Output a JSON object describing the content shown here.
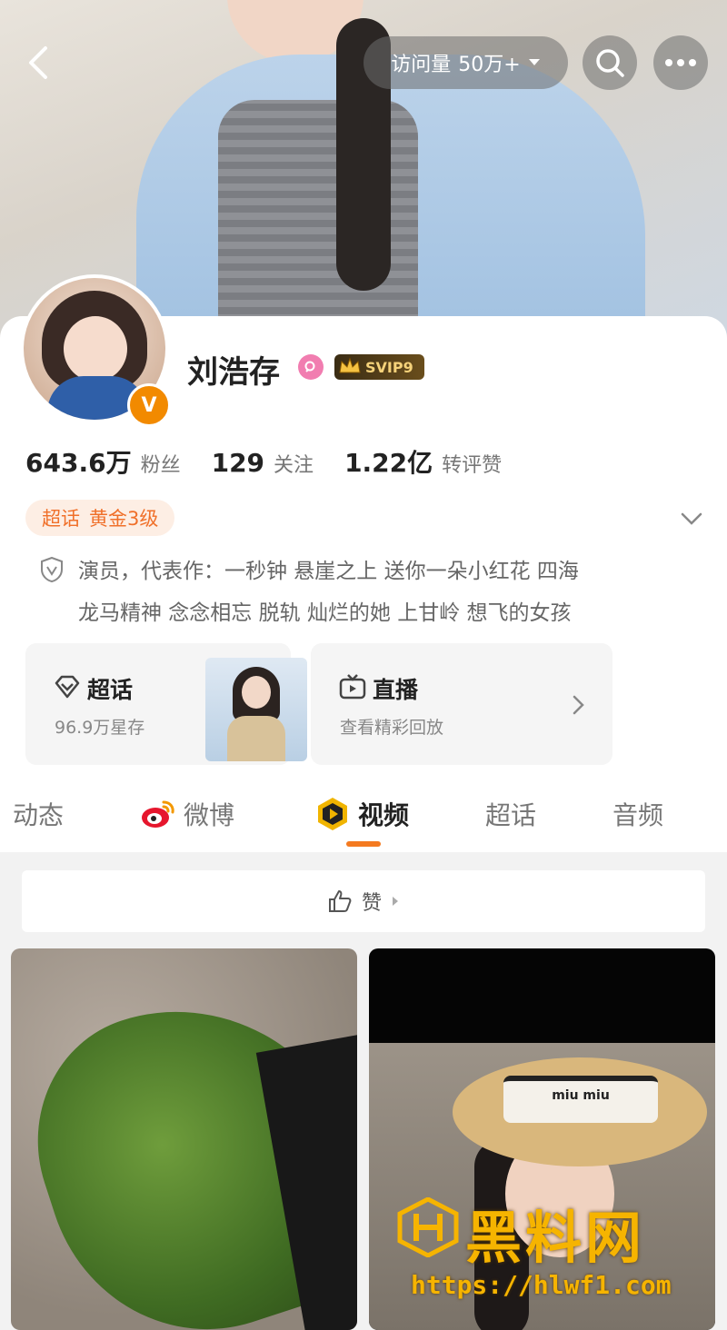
{
  "header": {
    "visit_label": "访问量",
    "visit_count": "50万+"
  },
  "profile": {
    "name": "刘浩存",
    "svip_label": "SVIP9",
    "verified_mark": "V",
    "stats": [
      {
        "value": "643.6万",
        "label": "粉丝"
      },
      {
        "value": "129",
        "label": "关注"
      },
      {
        "value": "1.22亿",
        "label": "转评赞"
      }
    ],
    "tag": {
      "part1": "超话",
      "part2": "黄金3级"
    },
    "bio_line1": "演员，代表作：一秒钟 悬崖之上 送你一朵小红花 四海",
    "bio_line2": "龙马精神 念念相忘 脱轨 灿烂的她 上甘岭 想飞的女孩"
  },
  "tiles": {
    "chaohua": {
      "title": "超话",
      "subtitle": "96.9万星存"
    },
    "live": {
      "title": "直播",
      "subtitle": "查看精彩回放"
    }
  },
  "tabs": [
    {
      "label": "动态"
    },
    {
      "label": "微博"
    },
    {
      "label": "视频"
    },
    {
      "label": "超话"
    },
    {
      "label": "音频"
    }
  ],
  "active_tab": "视频",
  "sort": {
    "label": "赞"
  },
  "videos": [
    {
      "hat_text": ""
    },
    {
      "hat_text": "miu miu"
    }
  ],
  "watermark": {
    "brand": "黑料网",
    "url": "https://hlwf1.com"
  },
  "colors": {
    "accent": "#f47a20",
    "tag_bg": "#fdeee4",
    "tag_text": "#f0702a",
    "watermark": "#f6b400"
  }
}
